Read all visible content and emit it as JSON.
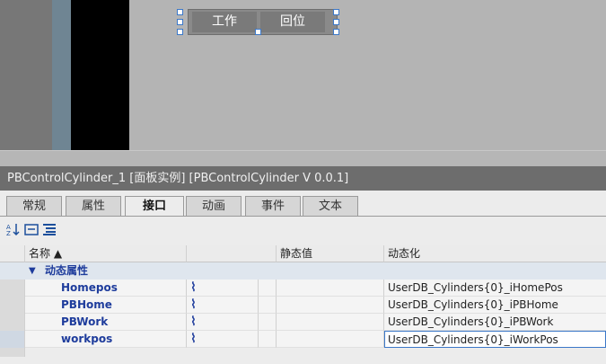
{
  "canvas": {
    "buttons": {
      "work": "工作",
      "home": "回位"
    }
  },
  "panel": {
    "title": "PBControlCylinder_1 [面板实例] [PBControlCylinder V 0.0.1]",
    "tabs": [
      "常规",
      "属性",
      "接口",
      "动画",
      "事件",
      "文本"
    ],
    "active_tab": "接口",
    "toolbar_icons": [
      "sort-icon",
      "collapse-icon",
      "expand-icon"
    ]
  },
  "table": {
    "headers": {
      "name": "名称 ▲",
      "static": "静态值",
      "dynamic": "动态化"
    },
    "group": {
      "toggle": "▼",
      "label": "动态属性"
    },
    "rows": [
      {
        "name": "Homepos",
        "icon": "dynamic-link-icon",
        "dynamic": "UserDB_Cylinders{0}_iHomePos"
      },
      {
        "name": "PBHome",
        "icon": "dynamic-link-icon",
        "dynamic": "UserDB_Cylinders{0}_iPBHome"
      },
      {
        "name": "PBWork",
        "icon": "dynamic-link-icon",
        "dynamic": "UserDB_Cylinders{0}_iPBWork"
      },
      {
        "name": "workpos",
        "icon": "dynamic-link-icon",
        "dynamic": "UserDB_Cylinders{0}_iWorkPos"
      }
    ]
  }
}
